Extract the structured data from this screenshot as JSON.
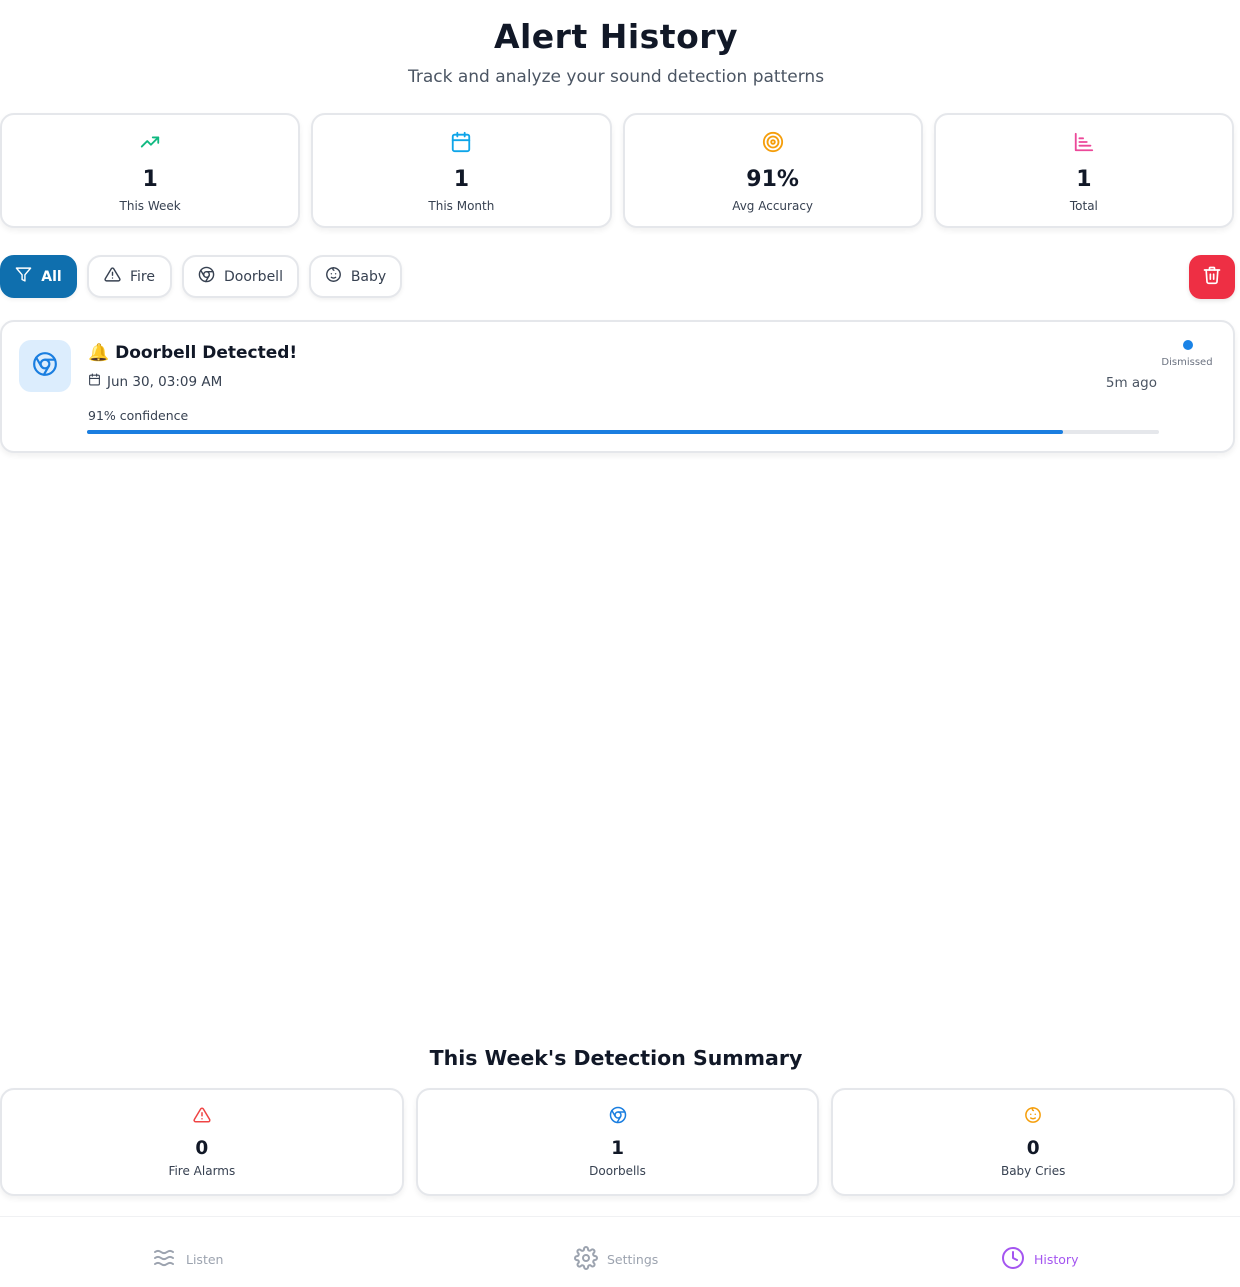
{
  "header": {
    "title": "Alert History",
    "subtitle": "Track and analyze your sound detection patterns"
  },
  "stats": [
    {
      "icon": "trending-up-icon",
      "value": "1",
      "label": "This Week",
      "color": "#10b981"
    },
    {
      "icon": "calendar-icon",
      "value": "1",
      "label": "This Month",
      "color": "#0ea5e9"
    },
    {
      "icon": "target-icon",
      "value": "91%",
      "label": "Avg Accuracy",
      "color": "#f59e0b"
    },
    {
      "icon": "bar-chart-icon",
      "value": "1",
      "label": "Total",
      "color": "#ec4899"
    }
  ],
  "filters": {
    "items": [
      {
        "icon": "filter-icon",
        "label": "All",
        "active": true
      },
      {
        "icon": "alert-triangle-icon",
        "label": "Fire",
        "active": false
      },
      {
        "icon": "chrome-icon",
        "label": "Doorbell",
        "active": false
      },
      {
        "icon": "baby-icon",
        "label": "Baby",
        "active": false
      }
    ],
    "clear_icon": "trash-icon"
  },
  "alerts": [
    {
      "icon": "chrome-icon",
      "title": "🔔 Doorbell Detected!",
      "date": "Jun 30, 03:09 AM",
      "ago": "5m ago",
      "status": "Dismissed",
      "confidence_label": "91% confidence",
      "confidence": 0.91
    }
  ],
  "summary": {
    "title": "This Week's Detection Summary",
    "items": [
      {
        "icon": "alert-triangle-icon",
        "value": "0",
        "label": "Fire Alarms",
        "color": "#ef4444"
      },
      {
        "icon": "chrome-icon",
        "value": "1",
        "label": "Doorbells",
        "color": "#1a7ee0"
      },
      {
        "icon": "baby-icon",
        "value": "0",
        "label": "Baby Cries",
        "color": "#f59e0b"
      }
    ]
  },
  "nav": {
    "items": [
      {
        "icon": "waves-icon",
        "label": "Listen",
        "active": false
      },
      {
        "icon": "settings-icon",
        "label": "Settings",
        "active": false
      },
      {
        "icon": "clock-icon",
        "label": "History",
        "active": true
      }
    ]
  },
  "colors": {
    "accent": "#0f6fae",
    "danger": "#ee2f44",
    "progress": "#1a7ee0",
    "nav_active": "#a455f0"
  }
}
